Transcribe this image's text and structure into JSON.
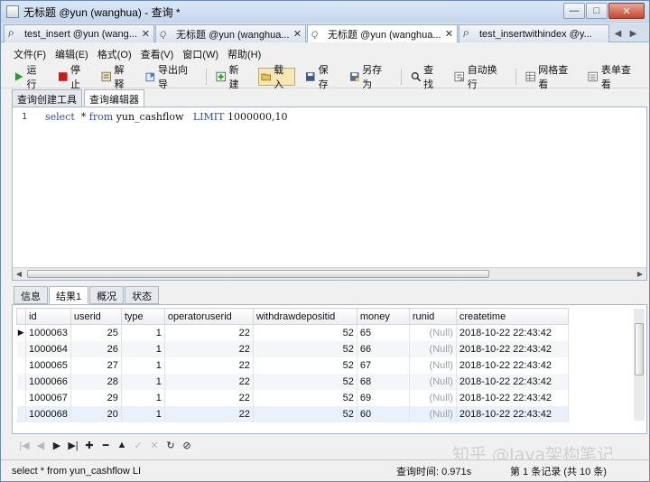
{
  "window": {
    "title": "无标题 @yun (wanghua) - 查询 *",
    "min": "—",
    "max": "□",
    "close": "✕"
  },
  "doc_tabs": [
    {
      "label": "test_insert @yun (wang...",
      "icon": "P"
    },
    {
      "label": "无标题 @yun (wanghua...",
      "icon": "Q"
    },
    {
      "label": "无标题 @yun (wanghua...",
      "icon": "Q"
    },
    {
      "label": "test_insertwithindex @y...",
      "icon": "P"
    }
  ],
  "menu": [
    "文件(F)",
    "编辑(E)",
    "格式(O)",
    "查看(V)",
    "窗口(W)",
    "帮助(H)"
  ],
  "toolbar": {
    "run": "运行",
    "stop": "停止",
    "explain": "解释",
    "export": "导出向导",
    "new": "新建",
    "load": "载入",
    "save": "保存",
    "save_as": "另存为",
    "find": "查找",
    "wrap": "自动换行",
    "grid_view": "网格查看",
    "form_view": "表单查看"
  },
  "sub_tabs": [
    "查询创建工具",
    "查询编辑器"
  ],
  "editor": {
    "line_number": "1",
    "kw_select": "select",
    "star": "  * ",
    "kw_from": "from",
    "table": " yun_cashflow   ",
    "kw_limit": "LIMIT",
    "limit_vals": " 1000000,10"
  },
  "result_tabs": [
    "信息",
    "结果1",
    "概况",
    "状态"
  ],
  "columns": [
    "id",
    "userid",
    "type",
    "operatoruserid",
    "withdrawdepositid",
    "money",
    "runid",
    "createtime"
  ],
  "rows": [
    [
      "1000063",
      "25",
      "1",
      "22",
      "52",
      "65",
      "(Null)",
      "2018-10-22 22:43:42"
    ],
    [
      "1000064",
      "26",
      "1",
      "22",
      "52",
      "66",
      "(Null)",
      "2018-10-22 22:43:42"
    ],
    [
      "1000065",
      "27",
      "1",
      "22",
      "52",
      "67",
      "(Null)",
      "2018-10-22 22:43:42"
    ],
    [
      "1000066",
      "28",
      "1",
      "22",
      "52",
      "68",
      "(Null)",
      "2018-10-22 22:43:42"
    ],
    [
      "1000067",
      "29",
      "1",
      "22",
      "52",
      "69",
      "(Null)",
      "2018-10-22 22:43:42"
    ],
    [
      "1000068",
      "20",
      "1",
      "22",
      "52",
      "60",
      "(Null)",
      "2018-10-22 22:43:42"
    ]
  ],
  "status": {
    "sql": "select  * from yun_cashflow   LI",
    "query_time": "查询时间: 0.971s",
    "record": "第 1 条记录 (共 10 条)"
  },
  "watermark": "知乎 @Java架构笔记",
  "colors": {
    "keyword": "#2b4bd0",
    "active_row": "#eaf1fb",
    "title_bg": "#c5d6ec"
  }
}
